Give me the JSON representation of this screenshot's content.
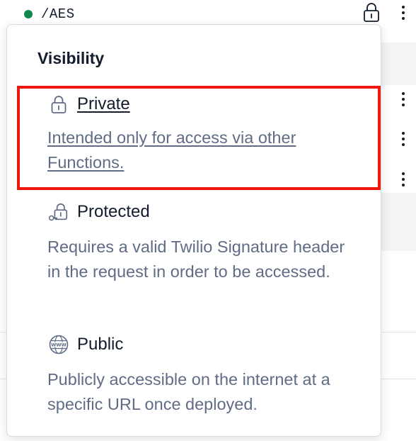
{
  "row": {
    "path": "/AES",
    "status_color": "#14854b",
    "lock_icon": "lock-icon",
    "menu_icon": "kebab-menu-icon"
  },
  "popover": {
    "title": "Visibility",
    "options": [
      {
        "label": "Private",
        "description": "Intended only for access via other Functions.",
        "icon": "lock-icon",
        "selected": true
      },
      {
        "label": "Protected",
        "description": "Requires a valid Twilio Signature header in the request in order to be accessed.",
        "icon": "key-lock-icon",
        "selected": false
      },
      {
        "label": "Public",
        "description": "Publicly accessible on the internet at a specific URL once deployed.",
        "icon": "globe-www-icon",
        "selected": false
      }
    ]
  },
  "colors": {
    "highlight": "#f2170c",
    "text_primary": "#121c2d",
    "text_secondary": "#606b85"
  }
}
